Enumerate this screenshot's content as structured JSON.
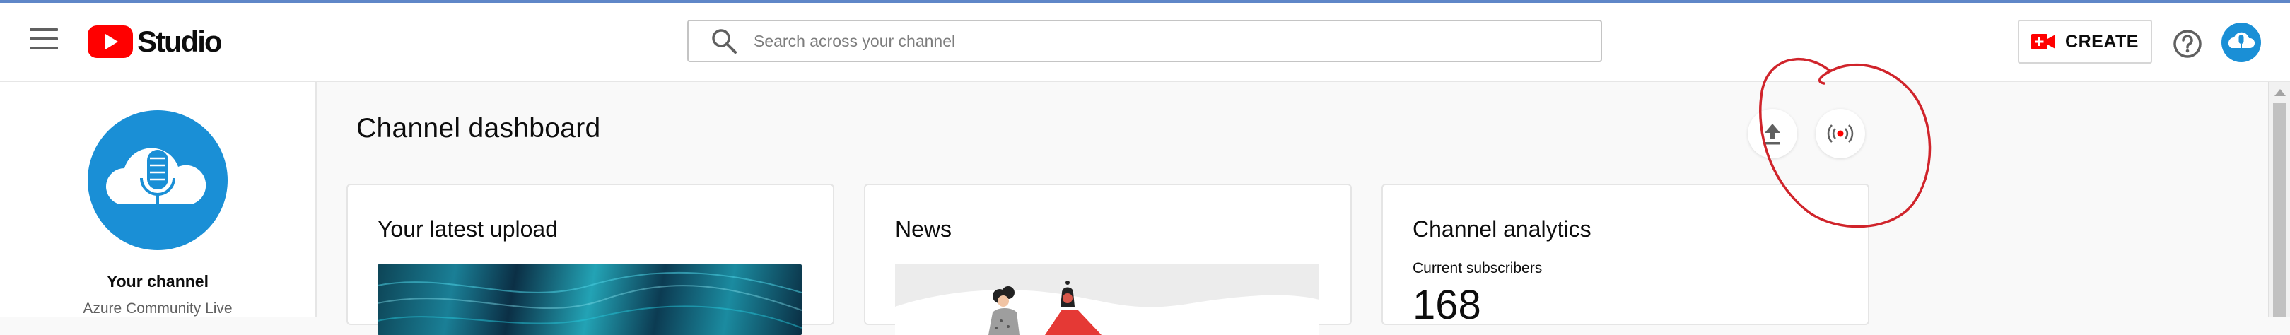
{
  "header": {
    "logo_text": "Studio",
    "search_placeholder": "Search across your channel",
    "create_label": "CREATE"
  },
  "sidebar": {
    "channel_heading": "Your channel",
    "channel_name": "Azure Community Live"
  },
  "main": {
    "title": "Channel dashboard",
    "cards": {
      "latest_upload_title": "Your latest upload",
      "news_title": "News",
      "analytics_title": "Channel analytics",
      "subscribers_label": "Current subscribers",
      "subscribers_value": "168"
    }
  },
  "icons": [
    "menu-icon",
    "youtube-play-icon",
    "search-icon",
    "video-camera-icon",
    "help-icon",
    "upload-icon",
    "go-live-icon",
    "microphone-cloud-icon"
  ],
  "colors": {
    "brand_red": "#ff0000",
    "avatar_blue": "#1a8fd6",
    "annotation_red": "#d0242b"
  }
}
